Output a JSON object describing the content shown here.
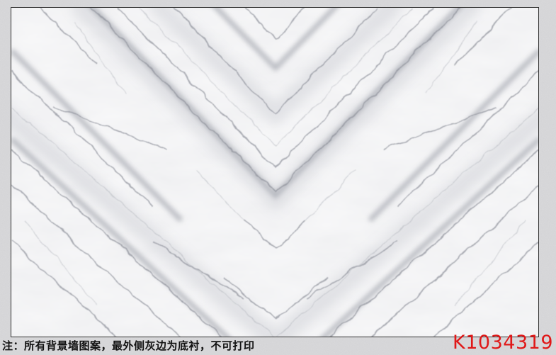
{
  "page": {
    "background_color": "#d9d9db",
    "accent_color": "#e01818"
  },
  "marble": {
    "pattern": "white bookmatched marble with grey veins in chevron pattern",
    "base_color": "#f7f7f8",
    "vein_color": "#9a9ca3"
  },
  "footer": {
    "note": "注：所有背景墙图案，最外侧灰边为底衬，不可打印",
    "code": "K1034319"
  }
}
